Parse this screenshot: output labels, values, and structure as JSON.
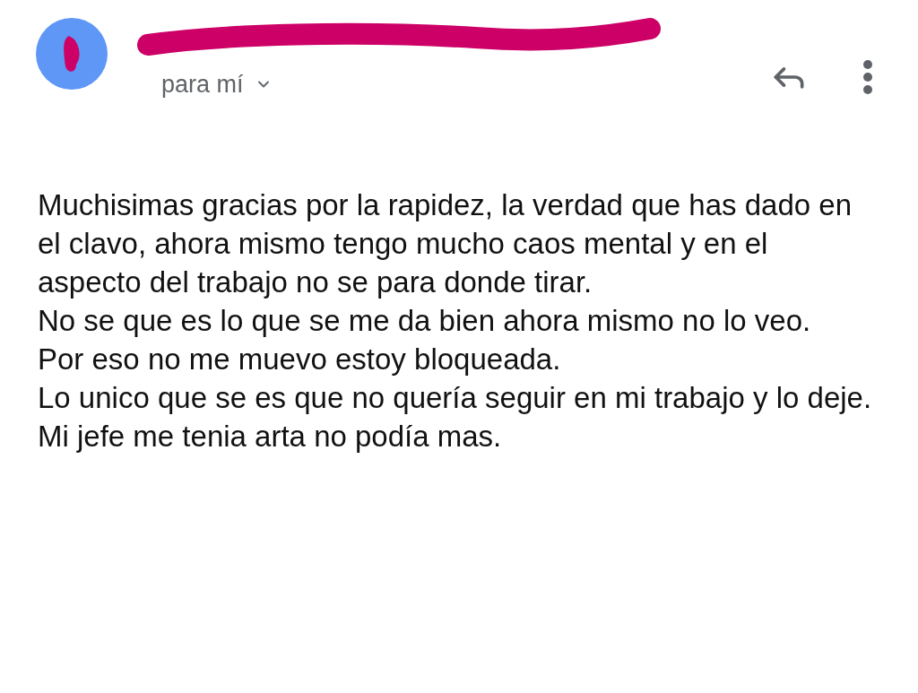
{
  "header": {
    "recipient_label": "para mí"
  },
  "body": {
    "paragraphs": [
      "Muchisimas gracias por la rapidez, la verdad que has dado en el clavo, ahora mismo tengo mucho caos mental y en el aspecto del trabajo no se para donde tirar.",
      "No se que es lo que se me da bien ahora mismo no lo veo.",
      "Por eso no me muevo estoy bloqueada.",
      "Lo unico que se es que no quería seguir en mi trabajo y lo deje.",
      "Mi jefe me tenia arta no podía mas."
    ]
  }
}
